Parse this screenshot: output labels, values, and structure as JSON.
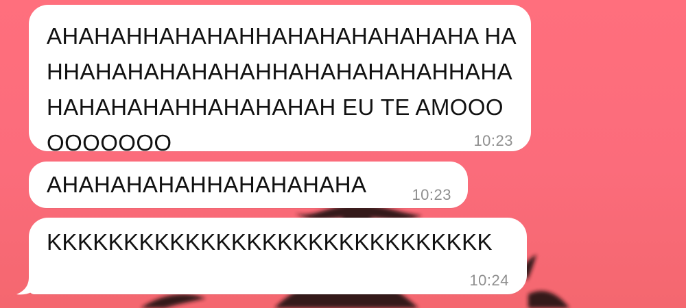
{
  "colors": {
    "background": "#ff6f7d",
    "bubble": "#ffffff",
    "text": "#111111",
    "timestamp": "#8f8f8f"
  },
  "messages": [
    {
      "text": "AHAHAHHAHAHAHHAHAHAHAHAHAHA HAHHAHAHAHAHAHAHHAHAHAHAHAHHAHA HAHAHAHAHHAHAHAHAH EU TE AMOOOOOOOOOO",
      "time": "10:23"
    },
    {
      "text": "AHAHAHAHAHHAHAHAHAHA",
      "time": "10:23"
    },
    {
      "text": "KKKKKKKKKKKKKKKKKKKKKKKKKKKKK",
      "time": "10:24"
    }
  ],
  "background_icon": "blurred-plant-silhouette"
}
